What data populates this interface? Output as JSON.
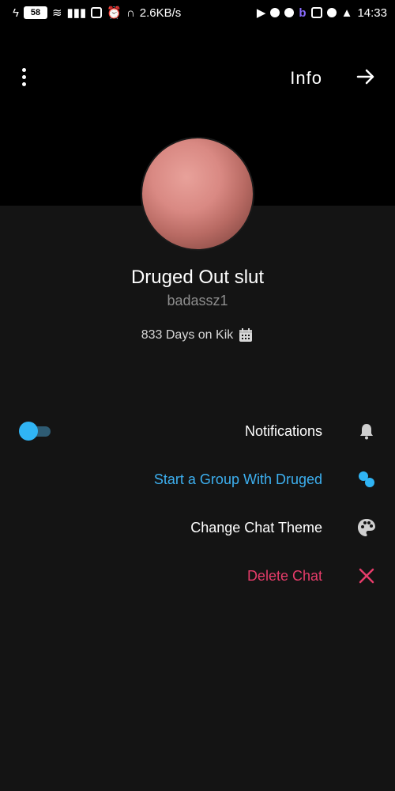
{
  "status_bar": {
    "time": "14:33",
    "battery": "58",
    "network_speed": "2.6KB/s"
  },
  "header": {
    "title": "Info"
  },
  "profile": {
    "name": "Druged Out slut",
    "username": "badassz1",
    "days_text": "833 Days on Kik"
  },
  "actions": [
    {
      "label": "Notifications",
      "color": "#ffffff",
      "icon": "bell-icon"
    },
    {
      "label": "Start a Group With Druged",
      "color": "#3db0f0",
      "icon": "group-icon"
    },
    {
      "label": "Change Chat Theme",
      "color": "#ffffff",
      "icon": "palette-icon"
    },
    {
      "label": "Delete Chat",
      "color": "#e63c6a",
      "icon": "close-icon"
    }
  ],
  "notifications_toggle_on": true,
  "colors": {
    "accent_blue": "#30b4f4",
    "delete_red": "#e63c6a",
    "background": "#141414",
    "header_bg": "#000000"
  }
}
